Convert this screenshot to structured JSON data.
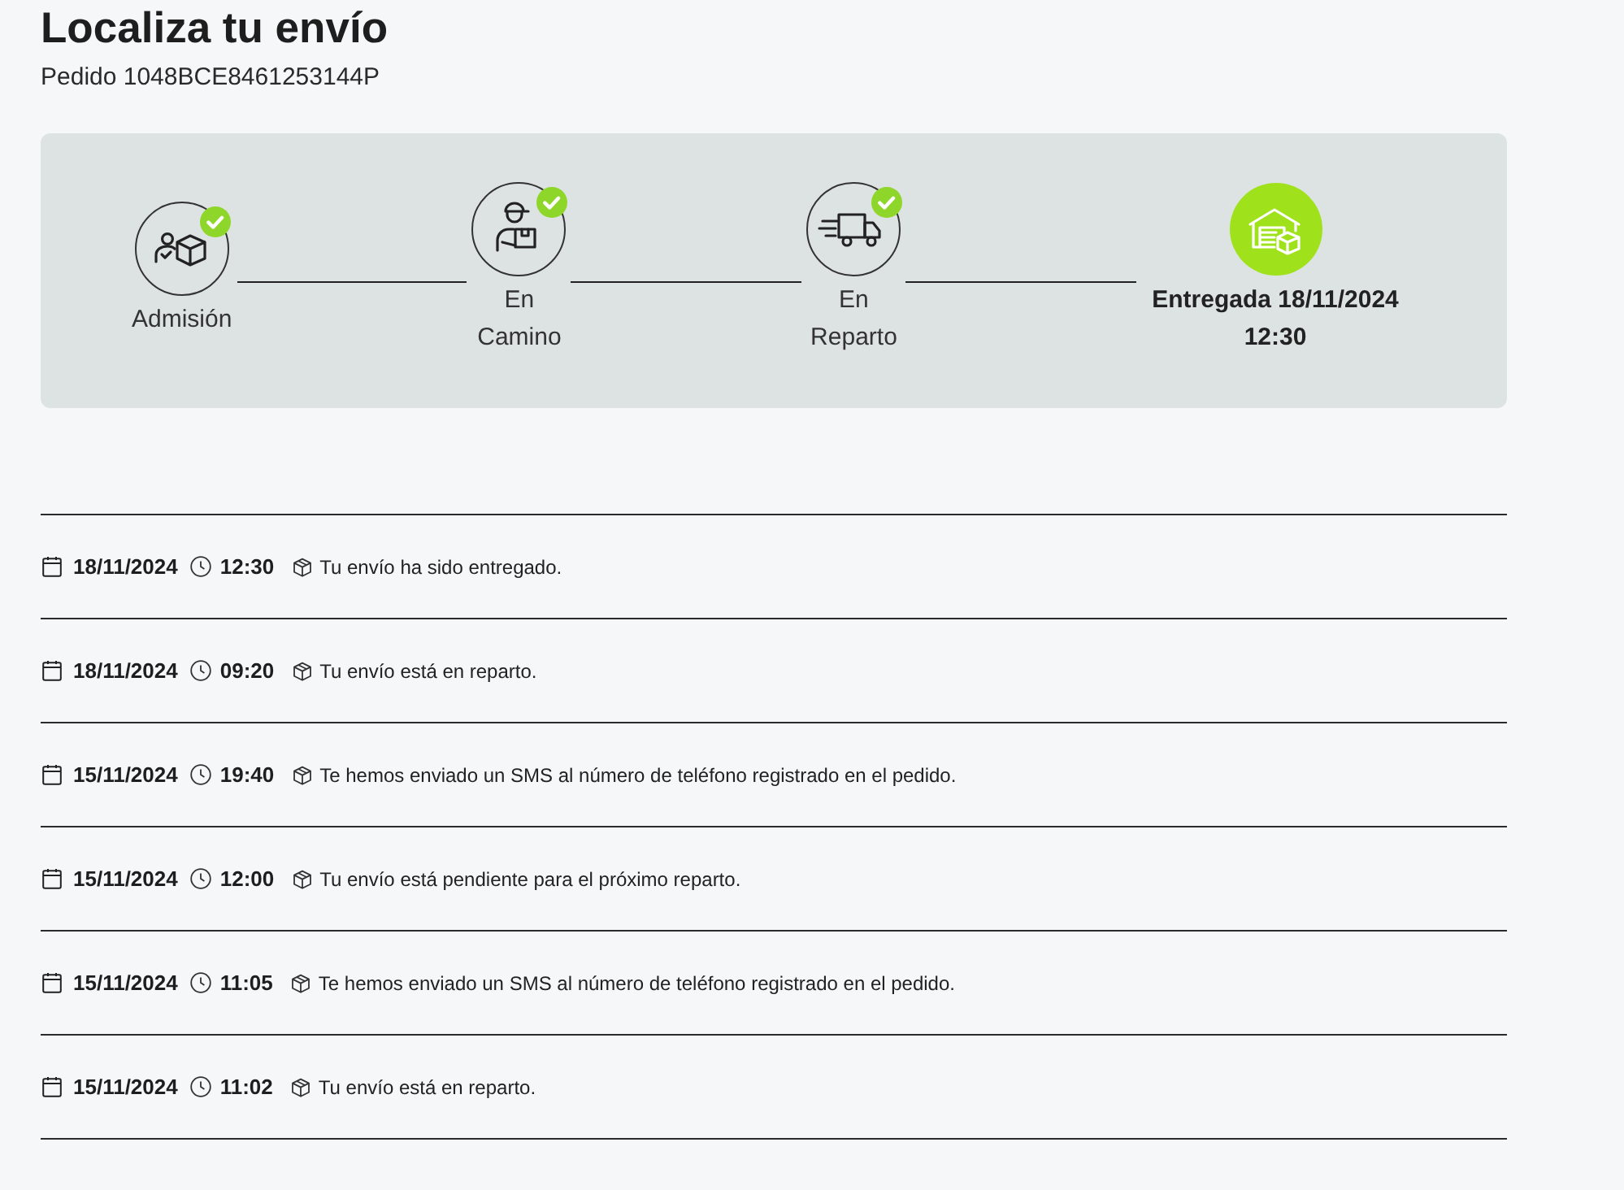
{
  "header": {
    "title": "Localiza tu envío",
    "order": "Pedido 1048BCE8461253144P"
  },
  "progress": [
    {
      "kind": "admission",
      "label": "Admisión",
      "completed": true,
      "current": false
    },
    {
      "kind": "in_transit",
      "label": "En Camino",
      "completed": true,
      "current": false
    },
    {
      "kind": "out_for_delivery",
      "label": "En Reparto",
      "completed": true,
      "current": false
    },
    {
      "kind": "delivered",
      "label": "Entregada 18/11/2024 12:30",
      "completed": false,
      "current": true
    }
  ],
  "events": [
    {
      "date": "18/11/2024",
      "time": "12:30",
      "message": "Tu envío ha sido entregado."
    },
    {
      "date": "18/11/2024",
      "time": "09:20",
      "message": "Tu envío está en reparto."
    },
    {
      "date": "15/11/2024",
      "time": "19:40",
      "message": "Te hemos enviado un SMS al número de teléfono registrado en el pedido."
    },
    {
      "date": "15/11/2024",
      "time": "12:00",
      "message": "Tu envío está pendiente para el próximo reparto."
    },
    {
      "date": "15/11/2024",
      "time": "11:05",
      "message": "Te hemos enviado un SMS al número de teléfono registrado en el pedido."
    },
    {
      "date": "15/11/2024",
      "time": "11:02",
      "message": "Tu envío está en reparto."
    }
  ]
}
